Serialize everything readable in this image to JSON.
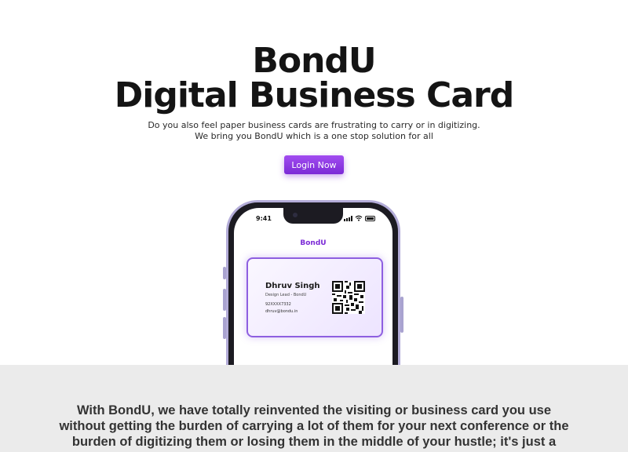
{
  "hero": {
    "title_line1": "BondU",
    "title_line2": "Digital Business Card",
    "subtitle_line1": "Do you also feel paper business cards are frustrating to carry or in digitizing.",
    "subtitle_line2": "We bring you BondU which is a one stop solution for all",
    "login_label": "Login Now"
  },
  "phone": {
    "time": "9:41",
    "app_name": "BondU",
    "card": {
      "name": "Dhruv Singh",
      "role": "Design Lead - BondU",
      "phone": "92XXXX7332",
      "email": "dhruv@bondu.in"
    }
  },
  "info": {
    "paragraph": "With BondU, we have totally reinvented the visiting or business card you use without getting the burden of carrying a lot of them for your next conference or the burden of digitizing them or losing them in the middle of your hustle; it's just a"
  },
  "colors": {
    "accent": "#8a3be6",
    "phone_frame": "#b3acd8",
    "info_background": "#ebebeb"
  }
}
